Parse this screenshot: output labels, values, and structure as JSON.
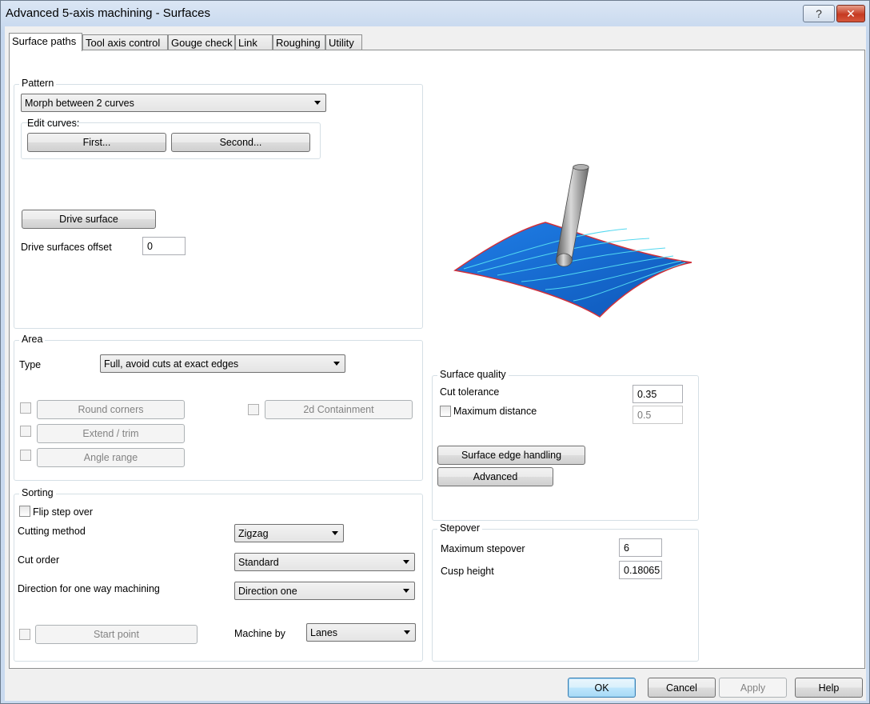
{
  "window": {
    "title": "Advanced 5-axis machining - Surfaces",
    "help_glyph": "?",
    "close_glyph": "✕"
  },
  "tabs": [
    {
      "label": "Surface paths",
      "active": true
    },
    {
      "label": "Tool axis control",
      "active": false
    },
    {
      "label": "Gouge check",
      "active": false
    },
    {
      "label": "Link",
      "active": false
    },
    {
      "label": "Roughing",
      "active": false
    },
    {
      "label": "Utility",
      "active": false
    }
  ],
  "pattern": {
    "group_label": "Pattern",
    "type_value": "Morph between 2 curves",
    "edit_curves_label": "Edit curves:",
    "first_button": "First...",
    "second_button": "Second...",
    "drive_surface_button": "Drive surface",
    "drive_offset_label": "Drive surfaces offset",
    "drive_offset_value": "0"
  },
  "area": {
    "group_label": "Area",
    "type_label": "Type",
    "type_value": "Full, avoid cuts at exact edges",
    "round_corners_button": "Round corners",
    "extend_trim_button": "Extend / trim",
    "angle_range_button": "Angle range",
    "containment_button": "2d Containment"
  },
  "sorting": {
    "group_label": "Sorting",
    "flip_step_over_label": "Flip step over",
    "cutting_method_label": "Cutting method",
    "cutting_method_value": "Zigzag",
    "cut_order_label": "Cut order",
    "cut_order_value": "Standard",
    "direction_label": "Direction for one way machining",
    "direction_value": "Direction one",
    "start_point_button": "Start point",
    "machine_by_label": "Machine by",
    "machine_by_value": "Lanes"
  },
  "surface_quality": {
    "group_label": "Surface quality",
    "cut_tolerance_label": "Cut tolerance",
    "cut_tolerance_value": "0.35",
    "max_distance_label": "Maximum distance",
    "max_distance_value": "0.5",
    "edge_handling_button": "Surface edge handling",
    "advanced_button": "Advanced"
  },
  "stepover": {
    "group_label": "Stepover",
    "max_stepover_label": "Maximum stepover",
    "max_stepover_value": "6",
    "cusp_height_label": "Cusp height",
    "cusp_height_value": "0.18065"
  },
  "footer": {
    "ok": "OK",
    "cancel": "Cancel",
    "apply": "Apply",
    "help": "Help"
  },
  "colors": {
    "surface_blue": "#1a6fd8",
    "toolpath_cyan": "#52d8f0",
    "edge_red": "#d0303a",
    "tool_gray": "#8a8a8a"
  }
}
